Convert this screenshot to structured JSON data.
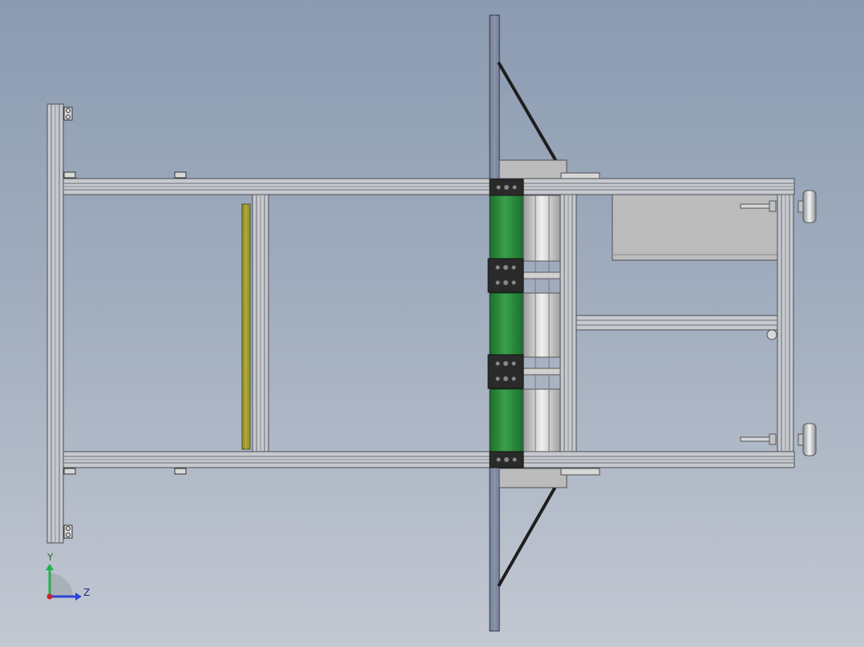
{
  "viewport": {
    "background_top": "#8b9bb1",
    "background_bottom": "#c3c8d2"
  },
  "model": {
    "frame_color": "#bfc3c8",
    "frame_edge_color": "#4a4d52",
    "roller_color": "#2f8a3e",
    "bracket_color": "#2a2a2a",
    "guard_color": "#9c9a2e",
    "box_color": "#bcbcbc",
    "knob_color": "#d5d7da",
    "tie_bar_color": "#1e1e1e"
  },
  "triad": {
    "y_label": "Y",
    "z_label": "Z",
    "y_color": "#22b14c",
    "z_color": "#2a45d8",
    "x_color": "#d0202a"
  }
}
